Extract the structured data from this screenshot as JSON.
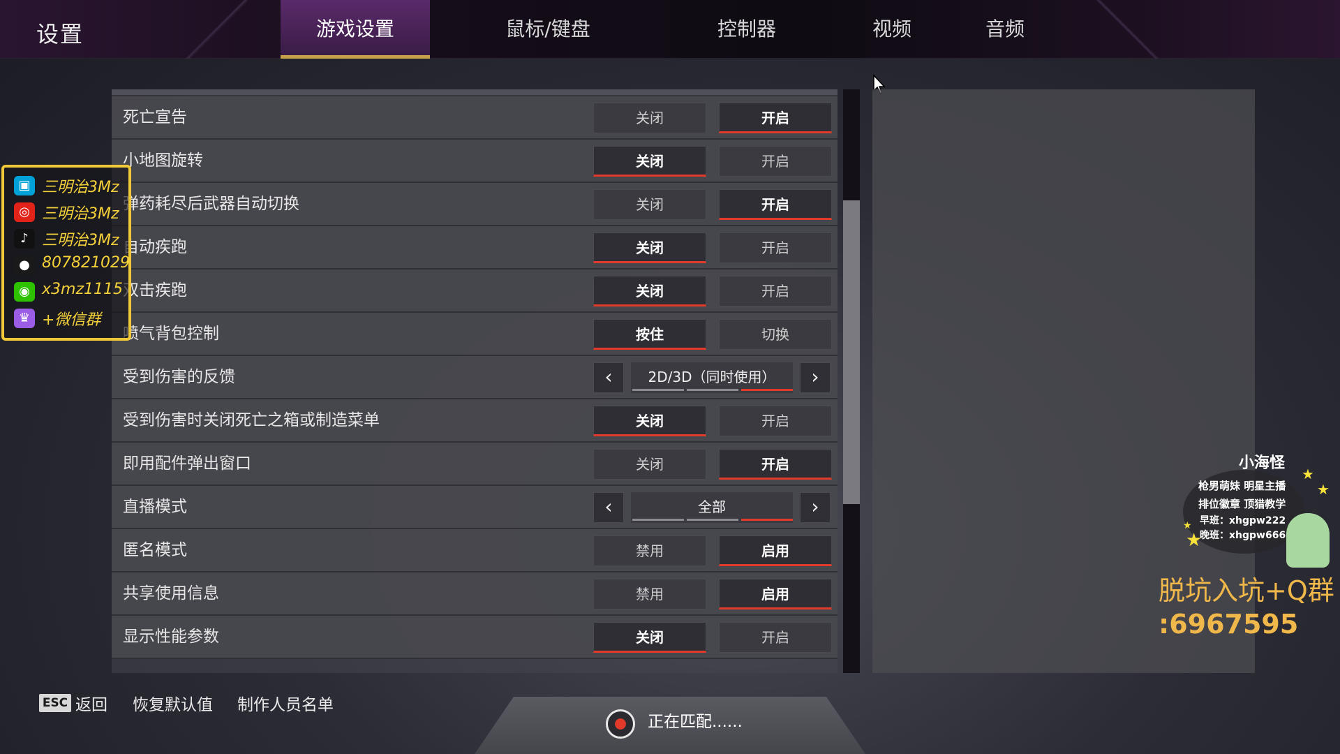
{
  "header": {
    "title": "设置",
    "tabs": [
      {
        "label": "游戏设置",
        "active": true
      },
      {
        "label": "鼠标/键盘",
        "active": false
      },
      {
        "label": "控制器",
        "active": false
      },
      {
        "label": "视频",
        "active": false
      },
      {
        "label": "音频",
        "active": false
      }
    ]
  },
  "settings": [
    {
      "label": "死亡宣告",
      "type": "toggle",
      "options": [
        "关闭",
        "开启"
      ],
      "selected": 1
    },
    {
      "label": "小地图旋转",
      "type": "toggle",
      "options": [
        "关闭",
        "开启"
      ],
      "selected": 0
    },
    {
      "label": "弹药耗尽后武器自动切换",
      "type": "toggle",
      "options": [
        "关闭",
        "开启"
      ],
      "selected": 1
    },
    {
      "label": "自动疾跑",
      "type": "toggle",
      "options": [
        "关闭",
        "开启"
      ],
      "selected": 0
    },
    {
      "label": "双击疾跑",
      "type": "toggle",
      "options": [
        "关闭",
        "开启"
      ],
      "selected": 0
    },
    {
      "label": "喷气背包控制",
      "type": "toggle",
      "options": [
        "按住",
        "切换"
      ],
      "selected": 0
    },
    {
      "label": "受到伤害的反馈",
      "type": "carousel",
      "value": "2D/3D（同时使用）",
      "segments": 3,
      "active_segment": 2
    },
    {
      "label": "受到伤害时关闭死亡之箱或制造菜单",
      "type": "toggle",
      "options": [
        "关闭",
        "开启"
      ],
      "selected": 0
    },
    {
      "label": "即用配件弹出窗口",
      "type": "toggle",
      "options": [
        "关闭",
        "开启"
      ],
      "selected": 1
    },
    {
      "label": "直播模式",
      "type": "carousel",
      "value": "全部",
      "segments": 3,
      "active_segment": 2
    },
    {
      "label": "匿名模式",
      "type": "toggle",
      "options": [
        "禁用",
        "启用"
      ],
      "selected": 1
    },
    {
      "label": "共享使用信息",
      "type": "toggle",
      "options": [
        "禁用",
        "启用"
      ],
      "selected": 1
    },
    {
      "label": "显示性能参数",
      "type": "toggle",
      "options": [
        "关闭",
        "开启"
      ],
      "selected": 0
    }
  ],
  "scroll": {
    "thumb_start": 0.19,
    "thumb_fraction": 0.52
  },
  "overlay": {
    "social": [
      {
        "icon": "bilibili-icon",
        "text": "三明治3Mz",
        "color": "#00a1d6"
      },
      {
        "icon": "netease-music-icon",
        "text": "三明治3Mz",
        "color": "#e2231a"
      },
      {
        "icon": "douyin-icon",
        "text": "三明治3Mz",
        "color": "#111111"
      },
      {
        "icon": "qq-icon",
        "text": "807821029",
        "color": "#1a1a1a"
      },
      {
        "icon": "wechat-icon",
        "text": "x3mz1115",
        "color": "#2dc100"
      },
      {
        "icon": "group-icon",
        "text": "+微信群",
        "color": "#9b5de5"
      }
    ],
    "badge": {
      "name": "小海怪",
      "lines": [
        "枪男萌妹 明星主播",
        "排位徽章 顶猎教学",
        "早班：xhgpw222",
        "晚班：xhgpw666"
      ]
    },
    "promo_line1": "脱坑入坑+Q群",
    "promo_line2": ":6967595"
  },
  "footer": {
    "esc_key": "ESC",
    "back": "返回",
    "restore_defaults": "恢复默认值",
    "credits": "制作人员名单",
    "matching": "正在匹配......"
  },
  "colors": {
    "accent_red": "#e23a2a",
    "tab_underline": "#c8a24a",
    "overlay_yellow": "#f6d23a"
  }
}
